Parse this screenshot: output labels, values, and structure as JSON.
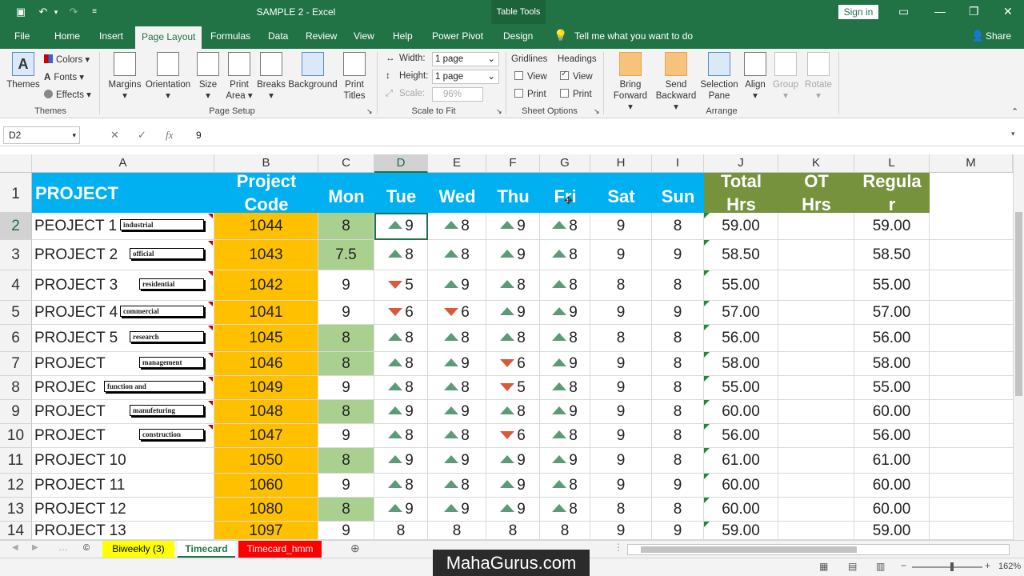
{
  "window": {
    "title": "SAMPLE 2  -  Excel",
    "context_tab": "Table Tools",
    "signin": "Sign in"
  },
  "tabs": [
    "File",
    "Home",
    "Insert",
    "Page Layout",
    "Formulas",
    "Data",
    "Review",
    "View",
    "Help",
    "Power Pivot",
    "Design"
  ],
  "tell_me": "Tell me what you want to do",
  "share": "Share",
  "ribbon": {
    "themes": {
      "themes": "Themes",
      "colors": "Colors",
      "fonts": "Fonts",
      "effects": "Effects",
      "group": "Themes"
    },
    "page_setup": {
      "margins": "Margins",
      "orientation": "Orientation",
      "size": "Size",
      "print_area_1": "Print",
      "print_area_2": "Area",
      "breaks": "Breaks",
      "background": "Background",
      "print_titles_1": "Print",
      "print_titles_2": "Titles",
      "group": "Page Setup"
    },
    "scale": {
      "width_label": "Width:",
      "width_value": "1 page",
      "height_label": "Height:",
      "height_value": "1 page",
      "scale_label": "Scale:",
      "scale_value": "96%",
      "group": "Scale to Fit"
    },
    "sheet_options": {
      "gridlines": "Gridlines",
      "headings": "Headings",
      "view": "View",
      "print": "Print",
      "group": "Sheet Options"
    },
    "arrange": {
      "bring_1": "Bring",
      "bring_2": "Forward",
      "send_1": "Send",
      "send_2": "Backward",
      "selection_1": "Selection",
      "selection_2": "Pane",
      "align": "Align",
      "group_btn": "Group",
      "rotate": "Rotate",
      "group": "Arrange"
    }
  },
  "formula_bar": {
    "name_box": "D2",
    "fx": "fx",
    "value": "9"
  },
  "columns": [
    "A",
    "B",
    "C",
    "D",
    "E",
    "F",
    "G",
    "H",
    "I",
    "J",
    "K",
    "L",
    "M"
  ],
  "header_row": {
    "row_number": "1",
    "project": "PROJECT",
    "code_1": "Project",
    "code_2": "Code",
    "days": [
      "Mon",
      "Tue",
      "Wed",
      "Thu",
      "Fri",
      "Sat",
      "Sun"
    ],
    "total_1": "Total",
    "total_2": "Hrs",
    "ot_1": "OT",
    "ot_2": "Hrs",
    "regular_1": "Regula",
    "regular_2": "r"
  },
  "rows": [
    {
      "n": "2",
      "project": "PEOJECT 1",
      "tag": "industrial",
      "code": "1044",
      "mon": "8",
      "tue": "9",
      "wed": "8",
      "thu": "9",
      "fri": "8",
      "sat": "9",
      "sun": "8",
      "total": "59.00",
      "regular": "59.00",
      "arrows": [
        "up",
        "up",
        "up",
        "up"
      ]
    },
    {
      "n": "3",
      "project": "PROJECT 2",
      "tag": "official",
      "code": "1043",
      "mon": "7.5",
      "tue": "8",
      "wed": "8",
      "thu": "9",
      "fri": "8",
      "sat": "9",
      "sun": "9",
      "total": "58.50",
      "regular": "58.50",
      "arrows": [
        "up",
        "up",
        "up",
        "up"
      ]
    },
    {
      "n": "4",
      "project": "PROJECT 3",
      "tag": "residential",
      "code": "1042",
      "mon": "9",
      "tue": "5",
      "wed": "9",
      "thu": "8",
      "fri": "8",
      "sat": "8",
      "sun": "8",
      "total": "55.00",
      "regular": "55.00",
      "arrows": [
        "down",
        "up",
        "up",
        "up"
      ]
    },
    {
      "n": "5",
      "project": "PROJECT 4",
      "tag": "commercial",
      "code": "1041",
      "mon": "9",
      "tue": "6",
      "wed": "6",
      "thu": "9",
      "fri": "9",
      "sat": "9",
      "sun": "9",
      "total": "57.00",
      "regular": "57.00",
      "arrows": [
        "down",
        "down",
        "up",
        "up"
      ]
    },
    {
      "n": "6",
      "project": "PROJECT 5",
      "tag": "research",
      "code": "1045",
      "mon": "8",
      "tue": "8",
      "wed": "8",
      "thu": "8",
      "fri": "8",
      "sat": "8",
      "sun": "8",
      "total": "56.00",
      "regular": "56.00",
      "arrows": [
        "up",
        "up",
        "up",
        "up"
      ]
    },
    {
      "n": "7",
      "project": "PROJECT",
      "tag": "management",
      "code": "1046",
      "mon": "8",
      "tue": "8",
      "wed": "9",
      "thu": "6",
      "fri": "9",
      "sat": "9",
      "sun": "8",
      "total": "58.00",
      "regular": "58.00",
      "arrows": [
        "up",
        "up",
        "down",
        "up"
      ]
    },
    {
      "n": "8",
      "project": "PROJEC",
      "tag": "function and",
      "code": "1049",
      "mon": "9",
      "tue": "8",
      "wed": "8",
      "thu": "5",
      "fri": "8",
      "sat": "9",
      "sun": "8",
      "total": "55.00",
      "regular": "55.00",
      "arrows": [
        "up",
        "up",
        "down",
        "up"
      ]
    },
    {
      "n": "9",
      "project": "PROJECT",
      "tag": "manufeturing",
      "code": "1048",
      "mon": "8",
      "tue": "9",
      "wed": "9",
      "thu": "8",
      "fri": "9",
      "sat": "9",
      "sun": "8",
      "total": "60.00",
      "regular": "60.00",
      "arrows": [
        "up",
        "up",
        "up",
        "up"
      ]
    },
    {
      "n": "10",
      "project": "PROJECT",
      "tag": "construction",
      "code": "1047",
      "mon": "9",
      "tue": "8",
      "wed": "8",
      "thu": "6",
      "fri": "8",
      "sat": "9",
      "sun": "8",
      "total": "56.00",
      "regular": "56.00",
      "arrows": [
        "up",
        "up",
        "down",
        "up"
      ]
    },
    {
      "n": "11",
      "project": "PROJECT 10",
      "tag": "",
      "code": "1050",
      "mon": "8",
      "tue": "9",
      "wed": "9",
      "thu": "9",
      "fri": "9",
      "sat": "9",
      "sun": "8",
      "total": "61.00",
      "regular": "61.00",
      "arrows": [
        "up",
        "up",
        "up",
        "up"
      ]
    },
    {
      "n": "12",
      "project": "PROJECT 11",
      "tag": "",
      "code": "1060",
      "mon": "9",
      "tue": "8",
      "wed": "8",
      "thu": "9",
      "fri": "8",
      "sat": "9",
      "sun": "9",
      "total": "60.00",
      "regular": "60.00",
      "arrows": [
        "up",
        "up",
        "up",
        "up"
      ]
    },
    {
      "n": "13",
      "project": "PROJECT 12",
      "tag": "",
      "code": "1080",
      "mon": "8",
      "tue": "9",
      "wed": "9",
      "thu": "9",
      "fri": "8",
      "sat": "8",
      "sun": "8",
      "total": "60.00",
      "regular": "60.00",
      "arrows": [
        "up",
        "up",
        "up",
        "up"
      ]
    },
    {
      "n": "14",
      "project": "PROJECT 13",
      "tag": "",
      "code": "1097",
      "mon": "9",
      "tue": "8",
      "wed": "8",
      "thu": "8",
      "fri": "8",
      "sat": "9",
      "sun": "9",
      "total": "59.00",
      "regular": "59.00",
      "arrows": [
        "none",
        "none",
        "none",
        "none"
      ]
    }
  ],
  "sheet_tabs": [
    {
      "label": "Biweekly (3)",
      "bg": "#ffff00",
      "fg": "#000000"
    },
    {
      "label": "Timecard",
      "bg": "#ffffff",
      "fg": "#217346"
    },
    {
      "label": "Timecard_hmm",
      "bg": "#ff0000",
      "fg": "#ffffff"
    }
  ],
  "zoom": "162%",
  "watermark": "MahaGurus.com",
  "colors": {
    "excel_green": "#217346",
    "header_blue": "#00b0f0",
    "header_olive": "#76923c",
    "code_orange": "#ffc000",
    "mon_green": "#a9d08e",
    "arrow_up": "#5b9b7a",
    "arrow_down": "#d9593b"
  }
}
